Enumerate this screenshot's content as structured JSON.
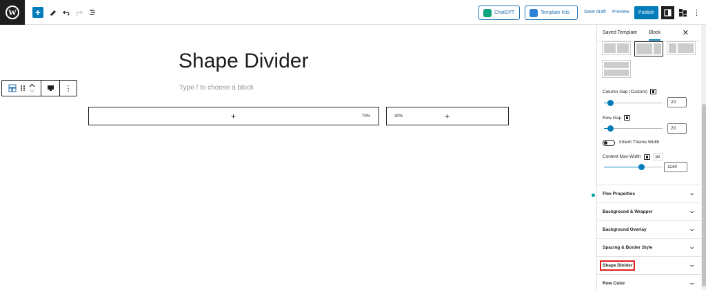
{
  "topbar": {
    "logo_letter": "W",
    "add_symbol": "+",
    "chatgpt_label": "ChatGPT",
    "template_kits_label": "Template Kits",
    "save_draft_label": "Save draft",
    "preview_label": "Preview",
    "publish_label": "Publish",
    "more_symbol": "⋮"
  },
  "editor": {
    "title": "Shape Divider",
    "placeholder": "Type / to choose a block",
    "columns": [
      {
        "plus": "+",
        "percent": "70%"
      },
      {
        "plus": "+",
        "percent": "30%"
      }
    ]
  },
  "sidebar": {
    "tabs": [
      "Saved Template",
      "Block"
    ],
    "active_tab": "Block",
    "close_symbol": "✕",
    "column_gap": {
      "label": "Column Gap (Custom)",
      "value": "20",
      "slider_fraction": 0.1
    },
    "row_gap": {
      "label": "Row Gap",
      "value": "20",
      "slider_fraction": 0.1
    },
    "inherit_theme_width": {
      "label": "Inherit Theme Width",
      "checked": false
    },
    "content_max_width": {
      "label": "Content Max-Width",
      "unit": "px",
      "value": "1140",
      "slider_fraction": 0.64
    },
    "panels": [
      "Flex Properties",
      "Background & Wrapper",
      "Background Overlay",
      "Spacing & Border Style",
      "Shape Divider",
      "Row Color"
    ],
    "highlighted_panel": "Shape Divider"
  },
  "colors": {
    "accent": "#007cba",
    "highlight": "#e01e1e"
  }
}
